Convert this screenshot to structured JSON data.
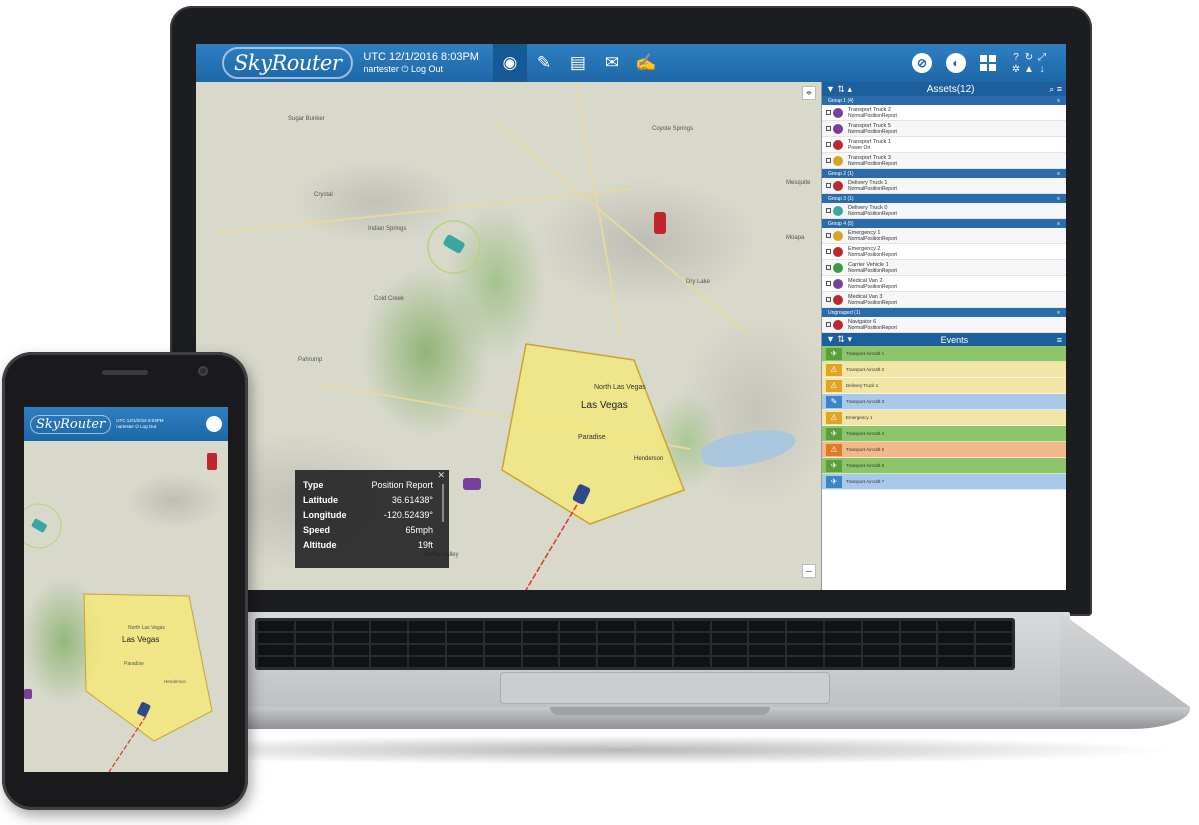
{
  "app": {
    "logo": "SkyRouter",
    "utc": "UTC 12/1/2016 8:03PM",
    "user": "nartester ⏻ Log Out"
  },
  "nav": [
    {
      "name": "nav-map",
      "glyph": "◉"
    },
    {
      "name": "nav-tools",
      "glyph": "✎"
    },
    {
      "name": "nav-reports",
      "glyph": "▤"
    },
    {
      "name": "nav-messages",
      "glyph": "✉"
    },
    {
      "name": "nav-edit",
      "glyph": "✍"
    }
  ],
  "map": {
    "towns": [
      "Sugar Bunker",
      "Coyote Springs",
      "Mesquite",
      "Indian Springs",
      "Cold Creek",
      "Dry Lake",
      "Pahrump",
      "Sandy Valley",
      "Crystal",
      "Moapa"
    ],
    "city_labels": [
      "North Las Vegas",
      "Las Vegas",
      "Paradise",
      "Henderson"
    ]
  },
  "popup": {
    "rows": [
      {
        "k": "Type",
        "v": "Position Report"
      },
      {
        "k": "Latitude",
        "v": "36.61438°"
      },
      {
        "k": "Longitude",
        "v": "-120.52439°"
      },
      {
        "k": "Speed",
        "v": "65mph"
      },
      {
        "k": "Altitude",
        "v": "19ft"
      }
    ]
  },
  "assets": {
    "title": "Assets(12)",
    "groups": [
      {
        "label": "Group 1 (4)",
        "items": [
          {
            "name": "Transport Truck 2",
            "type": "NormalPositionReport",
            "color": "#7a3e9d"
          },
          {
            "name": "Transport Truck 5",
            "type": "NormalPositionReport",
            "color": "#7a3e9d"
          },
          {
            "name": "Transport Truck 1",
            "type": "Power On",
            "color": "#c0272d"
          },
          {
            "name": "Transport Truck 3",
            "type": "NormalPositionReport",
            "color": "#d9a520"
          }
        ]
      },
      {
        "label": "Group 2 (1)",
        "items": [
          {
            "name": "Delivery Truck 1",
            "type": "NormalPositionReport",
            "color": "#c0272d"
          }
        ]
      },
      {
        "label": "Group 3 (1)",
        "items": [
          {
            "name": "Delivery Truck 0",
            "type": "NormalPositionReport",
            "color": "#3aa6a0"
          }
        ]
      },
      {
        "label": "Group 4 (5)",
        "items": [
          {
            "name": "Emergency 1",
            "type": "NormalPositionReport",
            "color": "#d9a520"
          },
          {
            "name": "Emergency 2",
            "type": "NormalPositionReport",
            "color": "#c0272d"
          },
          {
            "name": "Carrier Vehicle 1",
            "type": "NormalPositionReport",
            "color": "#3a9a4a"
          },
          {
            "name": "Medical Van 2",
            "type": "NormalPositionReport",
            "color": "#7a3e9d"
          },
          {
            "name": "Medical Van 3",
            "type": "NormalPositionReport",
            "color": "#c0272d"
          }
        ]
      },
      {
        "label": "Ungrouped (1)",
        "items": [
          {
            "name": "Navigator 6",
            "type": "NormalPositionReport",
            "color": "#c0272d"
          }
        ]
      }
    ]
  },
  "events": {
    "title": "Events",
    "rows": [
      {
        "label": "Transport Aircraft 1",
        "bg": "#8cc56a",
        "ico": "✈",
        "icobg": "#5ba03a"
      },
      {
        "label": "Transport Aircraft 2",
        "bg": "#f1e6a6",
        "ico": "⚠",
        "icobg": "#e0a526"
      },
      {
        "label": "Delivery Truck 1",
        "bg": "#f1e6a6",
        "ico": "⚠",
        "icobg": "#e0a526"
      },
      {
        "label": "Transport Aircraft 3",
        "bg": "#a8c9e8",
        "ico": "✎",
        "icobg": "#3d85c6"
      },
      {
        "label": "Emergency 1",
        "bg": "#f1e6a6",
        "ico": "⚠",
        "icobg": "#e0a526"
      },
      {
        "label": "Transport Aircraft 4",
        "bg": "#8cc56a",
        "ico": "✈",
        "icobg": "#5ba03a"
      },
      {
        "label": "Transport Aircraft 5",
        "bg": "#f4b98a",
        "ico": "⚠",
        "icobg": "#e07a26"
      },
      {
        "label": "Transport Aircraft 6",
        "bg": "#8cc56a",
        "ico": "✈",
        "icobg": "#5ba03a"
      },
      {
        "label": "Transport Aircraft 7",
        "bg": "#a8c9e8",
        "ico": "✈",
        "icobg": "#3d85c6"
      }
    ]
  },
  "phone": {
    "logo": "SkyRouter",
    "utc": "UTC 12/1/2016 8:03PM",
    "user": "nartester ⏻ Log Out",
    "city_labels": [
      "North Las Vegas",
      "Las Vegas",
      "Paradise",
      "Henderson"
    ]
  }
}
